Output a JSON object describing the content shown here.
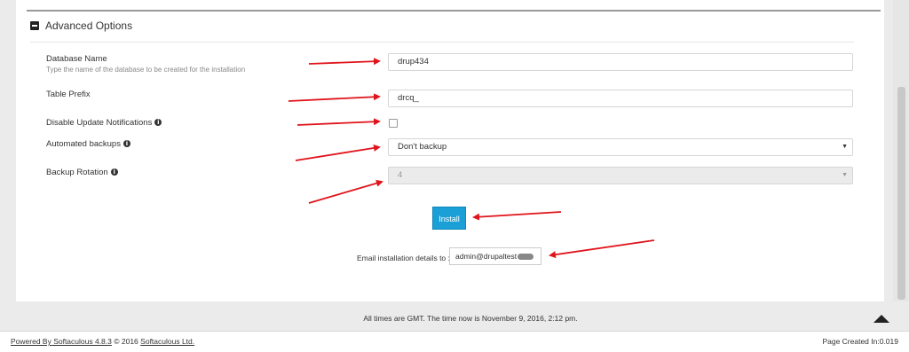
{
  "section": {
    "title": "Advanced Options"
  },
  "fields": {
    "database_name": {
      "label": "Database Name",
      "help": "Type the name of the database to be created for the installation",
      "value": "drup434"
    },
    "table_prefix": {
      "label": "Table Prefix",
      "value": "drcq_"
    },
    "disable_update": {
      "label": "Disable Update Notifications",
      "checked": false
    },
    "automated_backups": {
      "label": "Automated backups",
      "value": "Don't backup"
    },
    "backup_rotation": {
      "label": "Backup Rotation",
      "value": "4"
    }
  },
  "install_button": {
    "label": "Install"
  },
  "email": {
    "label": "Email installation details to :",
    "value": "admin@drupaltest"
  },
  "footer": {
    "gmt_note": "All times are GMT. The time now is November 9, 2016, 2:12 pm.",
    "powered_link": "Powered By Softaculous 4.8.3",
    "copyright": "© 2016",
    "company_link": "Softaculous Ltd.",
    "page_created": "Page Created In:0.019"
  },
  "icons": [
    "minus-square-icon",
    "info-icon",
    "caret-down-icon",
    "scroll-top-icon"
  ],
  "colors": {
    "accent": "#1aa0d6",
    "annotation_arrow": "#e0141c"
  }
}
